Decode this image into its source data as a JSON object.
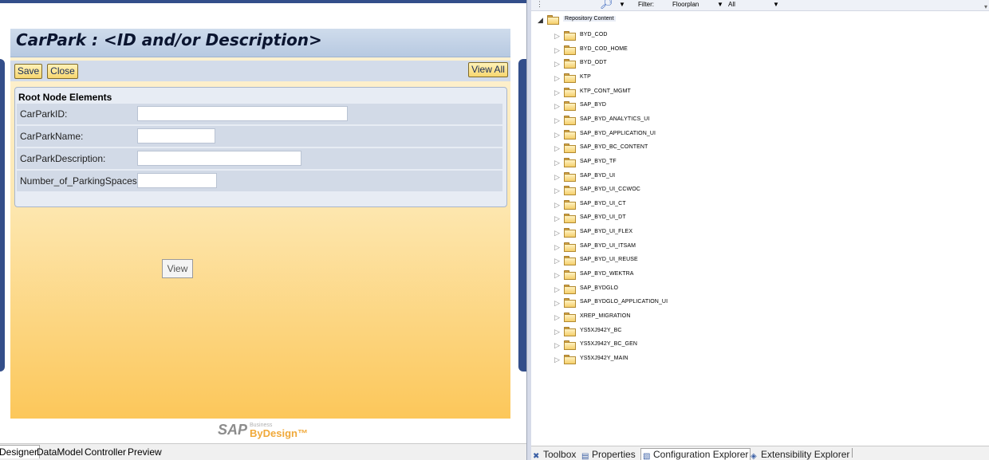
{
  "designer": {
    "title": "CarPark : <ID and/or Description>",
    "toolbar": {
      "save": "Save",
      "close": "Close",
      "view_all": "View All"
    },
    "section": {
      "title": "Root Node Elements",
      "fields": [
        {
          "label": "CarParkID:",
          "value": ""
        },
        {
          "label": "CarParkName:",
          "value": ""
        },
        {
          "label": "CarParkDescription:",
          "value": ""
        },
        {
          "label": "Number_of_ParkingSpaces:",
          "value": ""
        }
      ]
    },
    "view_button": "View",
    "brand": {
      "sap": "SAP",
      "business": "Business",
      "bydesign": "ByDesign™"
    },
    "bottom_tabs": [
      "Designer",
      "DataModel",
      "Controller",
      "Preview"
    ]
  },
  "repository": {
    "toolbar": {
      "filter_label": "Filter:",
      "filter_type": "Floorplan",
      "filter_value": "All",
      "icons": {
        "search": "search-icon",
        "caret": "dropdown-caret-icon"
      }
    },
    "root": "Repository Content",
    "items": [
      "BYD_COD",
      "BYD_COD_HOME",
      "BYD_ODT",
      "KTP",
      "KTP_CONT_MGMT",
      "SAP_BYD",
      "SAP_BYD_ANALYTICS_UI",
      "SAP_BYD_APPLICATION_UI",
      "SAP_BYD_BC_CONTENT",
      "SAP_BYD_TF",
      "SAP_BYD_UI",
      "SAP_BYD_UI_CCWOC",
      "SAP_BYD_UI_CT",
      "SAP_BYD_UI_DT",
      "SAP_BYD_UI_FLEX",
      "SAP_BYD_UI_ITSAM",
      "SAP_BYD_UI_REUSE",
      "SAP_BYD_WEKTRA",
      "SAP_BYDGLO",
      "SAP_BYDGLO_APPLICATION_UI",
      "XREP_MIGRATION",
      "YS5XJ942Y_BC",
      "YS5XJ942Y_BC_GEN",
      "YS5XJ942Y_MAIN"
    ],
    "bottom_tabs": [
      "Toolbox",
      "Properties",
      "Configuration Explorer",
      "Extensibility Explorer"
    ]
  }
}
